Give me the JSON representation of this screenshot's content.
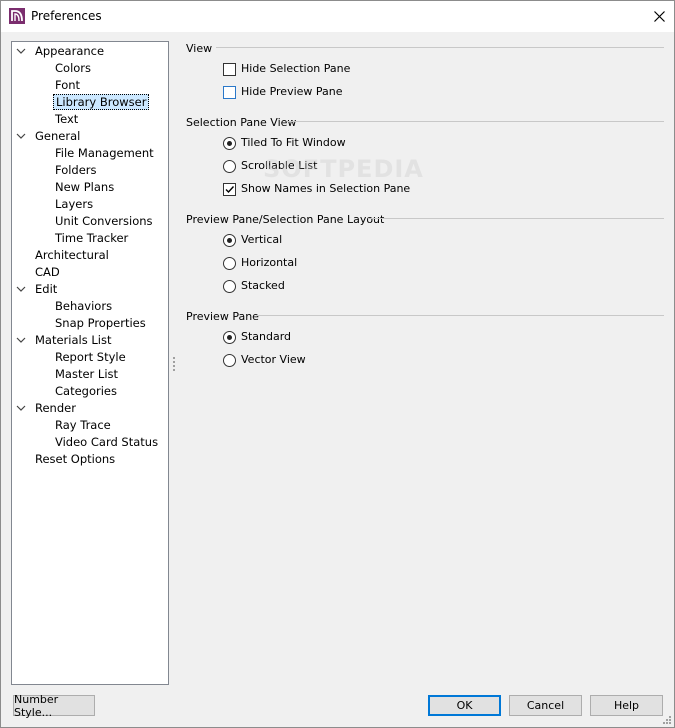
{
  "window": {
    "title": "Preferences"
  },
  "tree": {
    "items": [
      {
        "label": "Appearance",
        "level": 0,
        "expanded": true
      },
      {
        "label": "Colors",
        "level": 1
      },
      {
        "label": "Font",
        "level": 1
      },
      {
        "label": "Library Browser",
        "level": 1,
        "selected": true
      },
      {
        "label": "Text",
        "level": 1
      },
      {
        "label": "General",
        "level": 0,
        "expanded": true
      },
      {
        "label": "File Management",
        "level": 1
      },
      {
        "label": "Folders",
        "level": 1
      },
      {
        "label": "New Plans",
        "level": 1
      },
      {
        "label": "Layers",
        "level": 1
      },
      {
        "label": "Unit Conversions",
        "level": 1
      },
      {
        "label": "Time Tracker",
        "level": 1
      },
      {
        "label": "Architectural",
        "level": 0
      },
      {
        "label": "CAD",
        "level": 0
      },
      {
        "label": "Edit",
        "level": 0,
        "expanded": true
      },
      {
        "label": "Behaviors",
        "level": 1
      },
      {
        "label": "Snap Properties",
        "level": 1
      },
      {
        "label": "Materials List",
        "level": 0,
        "expanded": true
      },
      {
        "label": "Report Style",
        "level": 1
      },
      {
        "label": "Master List",
        "level": 1
      },
      {
        "label": "Categories",
        "level": 1
      },
      {
        "label": "Render",
        "level": 0,
        "expanded": true
      },
      {
        "label": "Ray Trace",
        "level": 1
      },
      {
        "label": "Video Card Status",
        "level": 1
      },
      {
        "label": "Reset Options",
        "level": 0
      }
    ]
  },
  "groups": {
    "view": {
      "label": "View",
      "hide_selection_pane": {
        "label": "Hide Selection Pane",
        "checked": false
      },
      "hide_preview_pane": {
        "label": "Hide Preview Pane",
        "checked": false
      }
    },
    "selection_pane_view": {
      "label": "Selection Pane View",
      "tiled": {
        "label": "Tiled To Fit Window",
        "selected": true
      },
      "scrollable": {
        "label": "Scrollable List",
        "selected": false
      },
      "show_names": {
        "label": "Show Names in Selection Pane",
        "checked": true
      }
    },
    "layout": {
      "label": "Preview Pane/Selection Pane Layout",
      "vertical": {
        "label": "Vertical",
        "selected": true
      },
      "horizontal": {
        "label": "Horizontal",
        "selected": false
      },
      "stacked": {
        "label": "Stacked",
        "selected": false
      }
    },
    "preview_pane": {
      "label": "Preview Pane",
      "standard": {
        "label": "Standard",
        "selected": true
      },
      "vector": {
        "label": "Vector View",
        "selected": false
      }
    }
  },
  "watermark": "SOFTPEDIA",
  "buttons": {
    "number_style": "Number Style...",
    "ok": "OK",
    "cancel": "Cancel",
    "help": "Help"
  },
  "colors": {
    "selection_bg": "#cce8ff",
    "default_button_border": "#0078d7",
    "app_icon": "#7b2d6e"
  }
}
